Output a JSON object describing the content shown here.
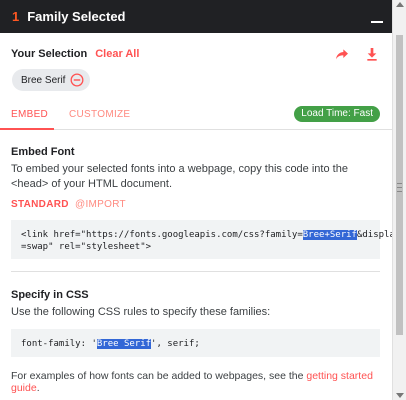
{
  "header": {
    "count": "1",
    "title": "Family Selected"
  },
  "selection": {
    "label": "Your Selection",
    "clear_label": "Clear All",
    "chips": [
      {
        "label": "Bree Serif"
      }
    ]
  },
  "tabs": {
    "embed": "EMBED",
    "customize": "CUSTOMIZE",
    "load_time": "Load Time: Fast"
  },
  "embed": {
    "title": "Embed Font",
    "description": "To embed your selected fonts into a webpage, copy this code into the <head> of your HTML document.",
    "subtabs": {
      "standard": "STANDARD",
      "import": "@IMPORT"
    },
    "code": {
      "line1_before": "<link href=\"https://fonts.googleapis.com/css?family=",
      "highlight": "Bree+Serif",
      "line1_after": "&display",
      "line2": "=swap\" rel=\"stylesheet\">"
    }
  },
  "css": {
    "title": "Specify in CSS",
    "description": "Use the following CSS rules to specify these families:",
    "code": {
      "before": "font-family: '",
      "highlight": "Bree Serif",
      "after": "', serif;"
    }
  },
  "footer": {
    "text": "For examples of how fonts can be added to webpages, see the ",
    "link": "getting started guide",
    "end": "."
  },
  "colors": {
    "accent": "#ff5252",
    "header_bg": "#202124",
    "count": "#ff5722",
    "badge": "#43a047",
    "highlight": "#3367d6"
  },
  "icons": {
    "minimize": "minimize-icon",
    "share": "share-icon",
    "download": "download-icon",
    "remove": "remove-circle-icon"
  }
}
